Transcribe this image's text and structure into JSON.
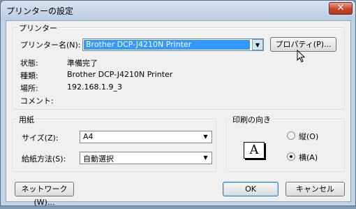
{
  "window": {
    "title": "プリンターの設定",
    "close_glyph": "✕"
  },
  "printer_group": {
    "legend": "プリンター",
    "name_label": "プリンター名(N):",
    "name_value": "Brother DCP-J4210N Printer",
    "properties_button": "プロパティ(P)...",
    "status_label": "状態:",
    "status_value": "準備完了",
    "type_label": "種類:",
    "type_value": "Brother DCP-J4210N Printer",
    "location_label": "場所:",
    "location_value": "192.168.1.9_3",
    "comment_label": "コメント:"
  },
  "paper_group": {
    "legend": "用紙",
    "size_label": "サイズ(Z):",
    "size_value": "A4",
    "source_label": "給紙方法(S):",
    "source_value": "自動選択"
  },
  "orientation_group": {
    "legend": "印刷の向き",
    "icon_letter": "A",
    "portrait_label": "縦(O)",
    "landscape_label": "横(A)",
    "selected": "landscape"
  },
  "buttons": {
    "network": "ネットワーク(W)...",
    "ok": "OK",
    "cancel": "キャンセル"
  }
}
